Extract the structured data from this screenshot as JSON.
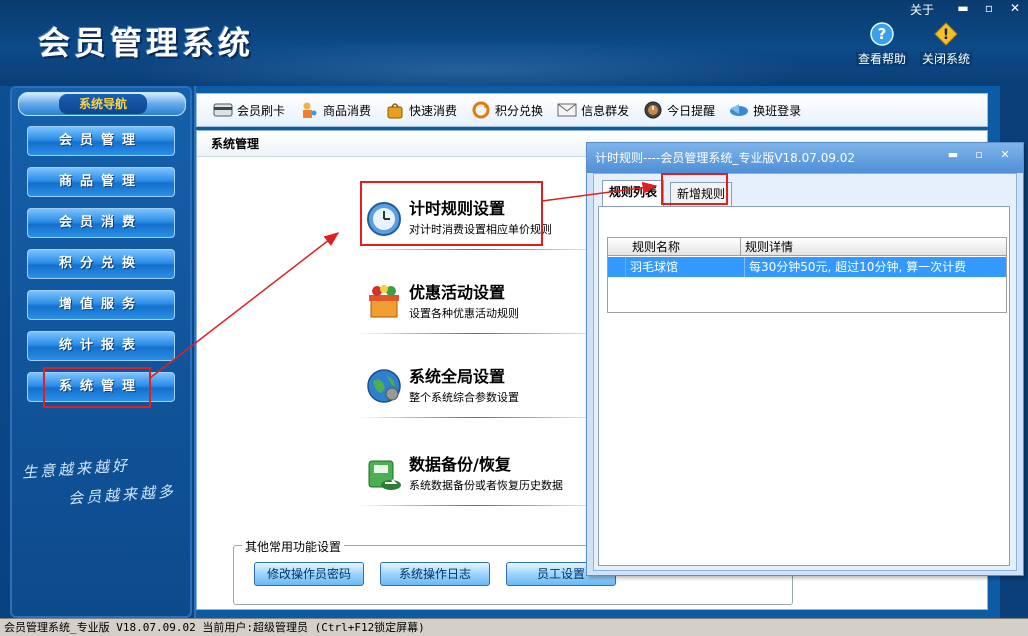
{
  "app": {
    "title": "会员管理系统",
    "window_controls": {
      "about": "关于",
      "minimize": "▬",
      "maximize": "▫",
      "close": "✕"
    },
    "top_tools": [
      {
        "label": "查看帮助",
        "icon": "help-icon"
      },
      {
        "label": "关闭系统",
        "icon": "warning-icon"
      }
    ]
  },
  "nav": {
    "header": "系统导航",
    "items": [
      {
        "label": "会员管理"
      },
      {
        "label": "商品管理"
      },
      {
        "label": "会员消费"
      },
      {
        "label": "积分兑换"
      },
      {
        "label": "增值服务"
      },
      {
        "label": "统计报表"
      },
      {
        "label": "系统管理"
      }
    ],
    "slogan": [
      "生意越来越好",
      "会员越来越多"
    ]
  },
  "toolbar": {
    "items": [
      {
        "label": "会员刷卡",
        "icon": "card-icon"
      },
      {
        "label": "商品消费",
        "icon": "shopping-icon"
      },
      {
        "label": "快速消费",
        "icon": "bag-icon"
      },
      {
        "label": "积分兑换",
        "icon": "exchange-icon"
      },
      {
        "label": "信息群发",
        "icon": "mail-icon"
      },
      {
        "label": "今日提醒",
        "icon": "clock-icon"
      },
      {
        "label": "换班登录",
        "icon": "shift-icon"
      }
    ]
  },
  "content": {
    "header": "系统管理",
    "settings": [
      {
        "title": "计时规则设置",
        "desc": "对计时消费设置相应单价规则",
        "icon": "timer-icon"
      },
      {
        "title": "优惠活动设置",
        "desc": "设置各种优惠活动规则",
        "icon": "gift-icon"
      },
      {
        "title": "系统全局设置",
        "desc": "整个系统综合参数设置",
        "icon": "globe-icon"
      },
      {
        "title": "数据备份/恢复",
        "desc": "系统数据备份或者恢复历史数据",
        "icon": "backup-icon"
      }
    ],
    "other_group": {
      "legend": "其他常用功能设置",
      "buttons": [
        "修改操作员密码",
        "系统操作日志",
        "员工设置"
      ]
    }
  },
  "status": "会员管理系统_专业版 V18.07.09.02 当前用户:超级管理员 (Ctrl+F12锁定屏幕)",
  "dialog": {
    "title": "计时规则----会员管理系统_专业版V18.07.09.02",
    "tabs": [
      "规则列表",
      "新增规则"
    ],
    "columns": [
      "规则名称",
      "规则详情"
    ],
    "rows": [
      {
        "name": "羽毛球馆",
        "detail": "每30分钟50元, 超过10分钟, 算一次计费"
      }
    ]
  },
  "colors": {
    "annotation_red": "#e02020",
    "selection_blue": "#3399ff",
    "brand_blue": "#0c4a88"
  }
}
